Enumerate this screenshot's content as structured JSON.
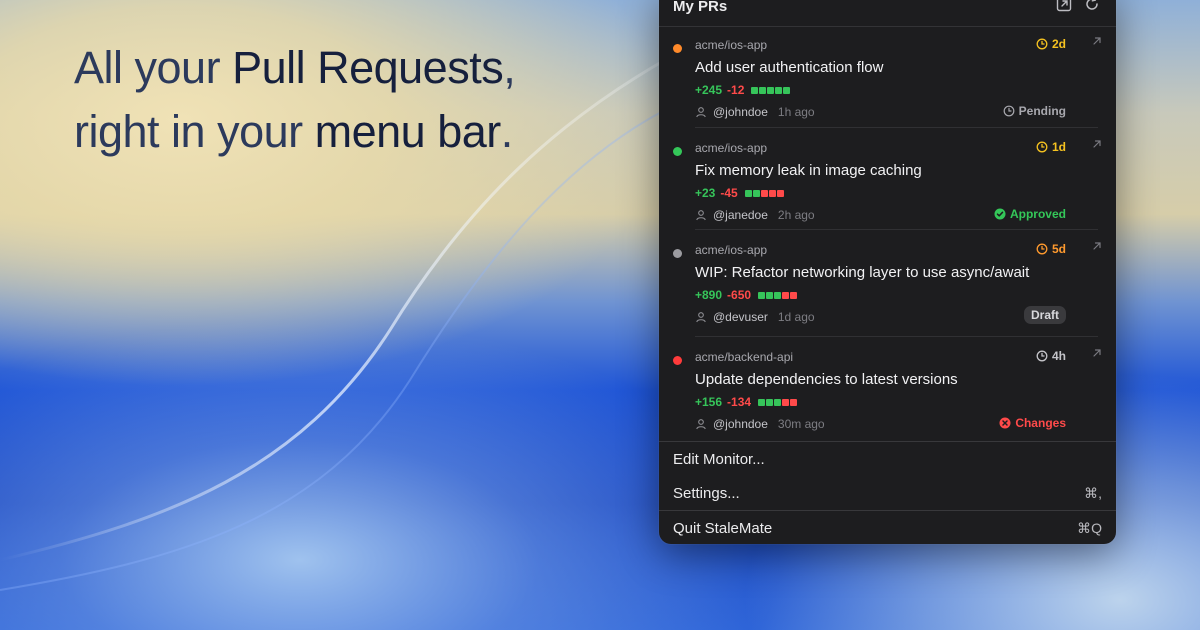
{
  "headline": {
    "line1_light": "All your ",
    "line1_strong": "Pull Requests",
    "line1_end": ",",
    "line2_light": "right in your ",
    "line2_strong": "menu bar",
    "line2_end": "."
  },
  "panel": {
    "title": "My PRs",
    "open_icon": "external-window-icon",
    "refresh_icon": "refresh-icon"
  },
  "prs": [
    {
      "repo": "acme/ios-app",
      "title": "Add user authentication flow",
      "additions": "+245",
      "deletions": "-12",
      "user": "@johndoe",
      "time": "1h ago",
      "age": "2d",
      "age_color": "#f5c220",
      "dot_color": "#ff8a2a",
      "status": "Pending",
      "status_type": "pending",
      "bars": [
        "#36c45a",
        "#36c45a",
        "#36c45a",
        "#36c45a",
        "#36c45a"
      ]
    },
    {
      "repo": "acme/ios-app",
      "title": "Fix memory leak in image caching",
      "additions": "+23",
      "deletions": "-45",
      "user": "@janedoe",
      "time": "2h ago",
      "age": "1d",
      "age_color": "#f5c220",
      "dot_color": "#34c759",
      "status": "Approved",
      "status_type": "approved",
      "bars": [
        "#36c45a",
        "#36c45a",
        "#ff4a4a",
        "#ff4a4a",
        "#ff4a4a"
      ]
    },
    {
      "repo": "acme/ios-app",
      "title": "WIP: Refactor networking layer to use async/await",
      "additions": "+890",
      "deletions": "-650",
      "user": "@devuser",
      "time": "1d ago",
      "age": "5d",
      "age_color": "#ff9a2e",
      "dot_color": "#9b9ba0",
      "status": "Draft",
      "status_type": "draft",
      "bars": [
        "#36c45a",
        "#36c45a",
        "#36c45a",
        "#ff4a4a",
        "#ff4a4a"
      ]
    },
    {
      "repo": "acme/backend-api",
      "title": "Update dependencies to latest versions",
      "additions": "+156",
      "deletions": "-134",
      "user": "@johndoe",
      "time": "30m ago",
      "age": "4h",
      "age_color": "#c4c4c9",
      "dot_color": "#ff3b3b",
      "status": "Changes",
      "status_type": "changes",
      "bars": [
        "#36c45a",
        "#36c45a",
        "#36c45a",
        "#ff4a4a",
        "#ff4a4a"
      ]
    }
  ],
  "menu": {
    "edit_monitor": "Edit Monitor...",
    "settings": "Settings...",
    "settings_shortcut": "⌘,",
    "quit": "Quit StaleMate",
    "quit_shortcut": "⌘Q"
  },
  "colors": {
    "status_pending": "#a8a8ae",
    "status_approved": "#34c759",
    "status_changes": "#ff4a4a"
  }
}
